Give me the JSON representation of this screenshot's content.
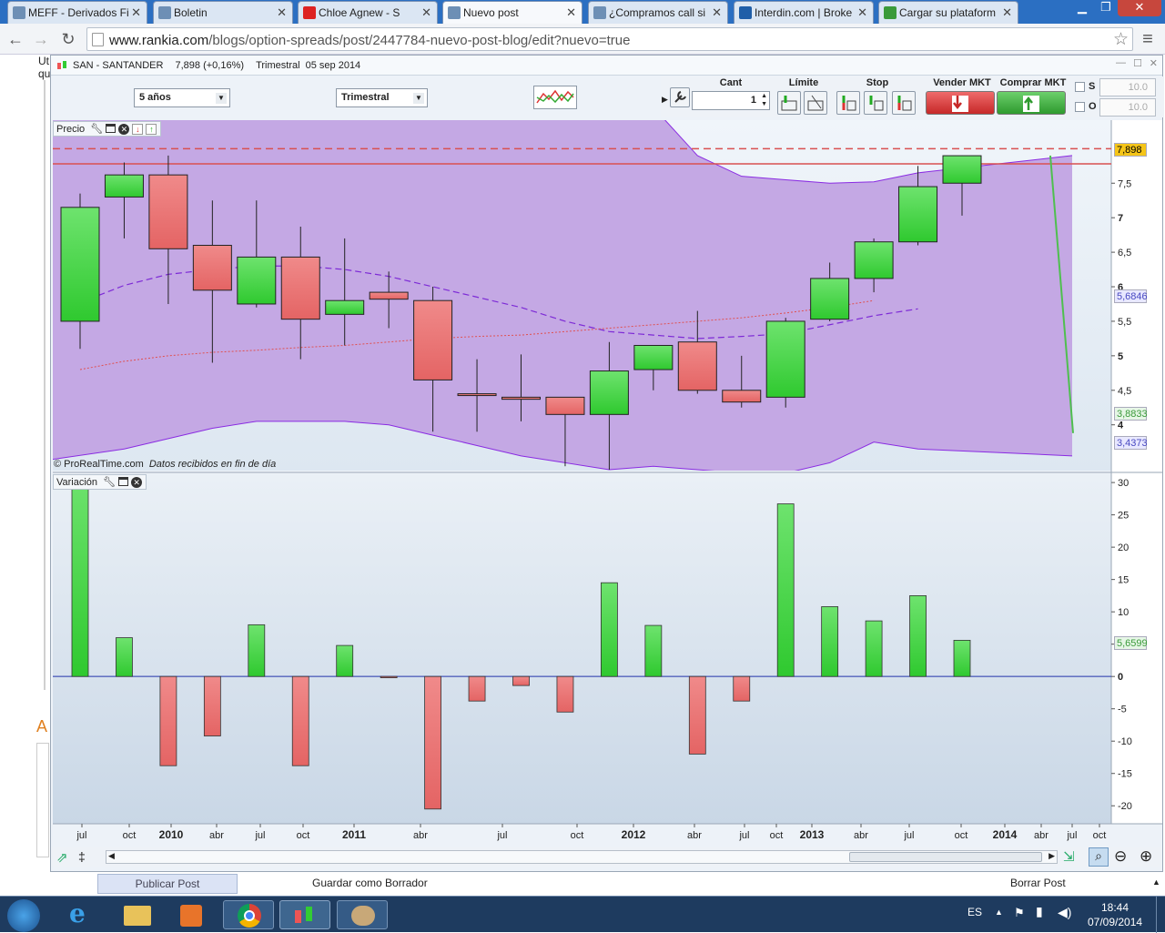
{
  "browser": {
    "tabs": [
      {
        "title": "MEFF - Derivados Fi",
        "active": false,
        "icon_color": "#6d8fb5"
      },
      {
        "title": "Boletin",
        "active": false,
        "icon_color": "#6d8fb5"
      },
      {
        "title": "Chloe Agnew - S",
        "active": false,
        "icon_color": "#d22"
      },
      {
        "title": "Nuevo post",
        "active": true,
        "icon_color": "#6d8fb5"
      },
      {
        "title": "¿Compramos call si",
        "active": false,
        "icon_color": "#6d8fb5"
      },
      {
        "title": "Interdin.com | Broke",
        "active": false,
        "icon_color": "#1f5ea8"
      },
      {
        "title": "Cargar su plataform",
        "active": false,
        "icon_color": "#3a9a3a"
      }
    ],
    "url_host": "www.rankia.com",
    "url_path": "/blogs/option-spreads/post/2447784-nuevo-post-blog/edit?nuevo=true"
  },
  "page_side_text": [
    "Ut",
    "qu",
    "A"
  ],
  "prorealtime": {
    "window_title": "SAN - SANTANDER",
    "price_info": "7,898 (+0,16%)",
    "period": "Trimestral",
    "date": "05 sep 2014",
    "range_select": "5 años",
    "period_select": "Trimestral",
    "order_panel": {
      "cant_label": "Cant",
      "cant_value": "1",
      "limite_label": "Límite",
      "stop_label": "Stop",
      "vender_label": "Vender MKT",
      "comprar_label": "Comprar MKT",
      "s_label": "S",
      "o_label": "O",
      "s_value": "10.0",
      "o_value": "10.0"
    },
    "price_panel_label": "Precio",
    "variation_panel_label": "Variación",
    "source_text": "© ProRealTime.com",
    "source_note": "Datos recibidos en fin de día",
    "price_axis_badges": [
      {
        "text": "7,898",
        "bg": "#f5c518",
        "color": "#000"
      },
      {
        "text": "5,6846",
        "bg": "#e8e8ff",
        "color": "#4848c0"
      },
      {
        "text": "3,8833",
        "bg": "#e6f6e6",
        "color": "#3a9a3a"
      },
      {
        "text": "3,4373",
        "bg": "#e8e8ff",
        "color": "#4848c0"
      }
    ],
    "variation_badge": "5,6599"
  },
  "chart_data": [
    {
      "type": "candlestick",
      "title": "Precio",
      "x_tick_labels": [
        "jul",
        "oct",
        "2010",
        "abr",
        "jul",
        "oct",
        "2011",
        "abr",
        "jul",
        "oct",
        "2012",
        "abr",
        "jul",
        "oct",
        "2013",
        "abr",
        "jul",
        "oct",
        "2014",
        "abr",
        "jul",
        "oct"
      ],
      "y_ticks": [
        4,
        4.5,
        5,
        5.5,
        6,
        6.5,
        7,
        7.5
      ],
      "ylim": [
        3.35,
        8.4
      ],
      "candles": [
        {
          "q": "Q3 2009",
          "open": 5.5,
          "high": 7.35,
          "low": 5.1,
          "close": 7.15
        },
        {
          "q": "Q4 2009",
          "open": 7.3,
          "high": 7.8,
          "low": 6.7,
          "close": 7.62
        },
        {
          "q": "Q1 2010",
          "open": 7.62,
          "high": 7.9,
          "low": 5.75,
          "close": 6.55
        },
        {
          "q": "Q2 2010",
          "open": 6.6,
          "high": 7.25,
          "low": 4.9,
          "close": 5.95
        },
        {
          "q": "Q3 2010",
          "open": 5.75,
          "high": 7.25,
          "low": 5.7,
          "close": 6.43
        },
        {
          "q": "Q4 2010",
          "open": 6.43,
          "high": 6.87,
          "low": 4.95,
          "close": 5.53
        },
        {
          "q": "Q1 2011",
          "open": 5.6,
          "high": 6.7,
          "low": 5.15,
          "close": 5.8
        },
        {
          "q": "Q2 2011",
          "open": 5.92,
          "high": 6.22,
          "low": 5.4,
          "close": 5.82
        },
        {
          "q": "Q3 2011",
          "open": 5.8,
          "high": 6.0,
          "low": 3.9,
          "close": 4.65
        },
        {
          "q": "Q4 2011",
          "open": 4.45,
          "high": 4.95,
          "low": 3.9,
          "close": 4.43
        },
        {
          "q": "Q1 2012",
          "open": 4.4,
          "high": 5.02,
          "low": 4.05,
          "close": 4.37
        },
        {
          "q": "Q2 2012",
          "open": 4.4,
          "high": 4.4,
          "low": 3.4,
          "close": 4.15
        },
        {
          "q": "Q3 2012",
          "open": 4.15,
          "high": 5.2,
          "low": 3.35,
          "close": 4.78
        },
        {
          "q": "Q4 2012",
          "open": 4.8,
          "high": 5.15,
          "low": 4.5,
          "close": 5.15
        },
        {
          "q": "Q1 2013",
          "open": 5.2,
          "high": 5.65,
          "low": 4.45,
          "close": 4.5
        },
        {
          "q": "Q2 2013",
          "open": 4.5,
          "high": 5.0,
          "low": 4.25,
          "close": 4.33
        },
        {
          "q": "Q3 2013",
          "open": 4.4,
          "high": 5.55,
          "low": 4.25,
          "close": 5.5
        },
        {
          "q": "Q4 2013",
          "open": 5.53,
          "high": 6.35,
          "low": 5.5,
          "close": 6.12
        },
        {
          "q": "Q1 2014",
          "open": 6.12,
          "high": 6.7,
          "low": 5.92,
          "close": 6.65
        },
        {
          "q": "Q2 2014",
          "open": 6.65,
          "high": 7.75,
          "low": 6.6,
          "close": 7.45
        },
        {
          "q": "Q3 2014",
          "open": 7.5,
          "high": 7.9,
          "low": 7.03,
          "close": 7.898
        }
      ],
      "lines": {
        "bollinger_upper": [
          9.5,
          9.5,
          9.5,
          9.5,
          9.5,
          9.5,
          9.5,
          9.5,
          9.5,
          9.5,
          9.5,
          9.5,
          9.4,
          8.6,
          7.9,
          7.6,
          7.55,
          7.5,
          7.52,
          7.65,
          7.9
        ],
        "bollinger_lower": [
          3.5,
          3.65,
          3.8,
          3.95,
          4.05,
          4.05,
          4.05,
          4.0,
          3.85,
          3.7,
          3.55,
          3.45,
          3.35,
          3.4,
          3.35,
          3.3,
          3.3,
          3.45,
          3.75,
          3.65,
          3.55
        ],
        "moving_avg_dashed": [
          5.77,
          6.02,
          6.18,
          6.25,
          6.3,
          6.3,
          6.25,
          6.15,
          6.0,
          5.85,
          5.7,
          5.5,
          5.35,
          5.3,
          5.25,
          5.28,
          5.32,
          5.45,
          5.58,
          5.68
        ],
        "moving_avg_dotted": [
          4.8,
          4.92,
          5.0,
          5.05,
          5.08,
          5.12,
          5.15,
          5.2,
          5.25,
          5.28,
          5.3,
          5.35,
          5.4,
          5.45,
          5.5,
          5.55,
          5.62,
          5.7,
          5.8
        ]
      },
      "h_lines": [
        {
          "value": 8.0,
          "style": "dashed",
          "color": "#d95050"
        },
        {
          "value": 7.78,
          "style": "solid",
          "color": "#d95050"
        }
      ]
    },
    {
      "type": "bar",
      "title": "Variación",
      "y_ticks": [
        30,
        25,
        20,
        15,
        10,
        5,
        0,
        -5,
        -10,
        -15,
        -20
      ],
      "ylim": [
        -22.5,
        31
      ],
      "values": [
        31,
        6,
        -13.8,
        -9.2,
        8,
        -13.8,
        4.8,
        -0.2,
        -20.5,
        -3.8,
        -1.4,
        -5.5,
        14.5,
        7.9,
        -12,
        -3.8,
        26.7,
        10.8,
        8.6,
        12.5,
        5.6
      ]
    }
  ],
  "editor_actions": {
    "publish": "Publicar Post",
    "draft": "Guardar como Borrador",
    "delete": "Borrar Post"
  },
  "taskbar": {
    "language": "ES",
    "time": "18:44",
    "date": "07/09/2014"
  }
}
